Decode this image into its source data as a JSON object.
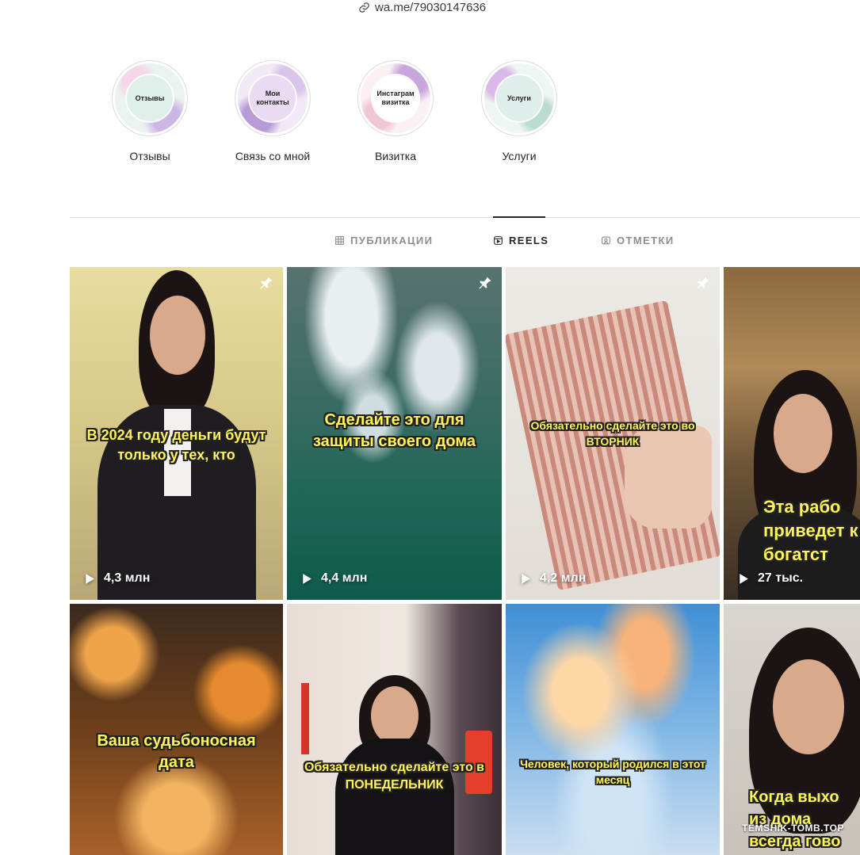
{
  "profile": {
    "link_text": "wa.me/79030147636"
  },
  "highlights": [
    {
      "cover_text": "Отзывы",
      "caption": "Отзывы",
      "tint": "#dff0ea"
    },
    {
      "cover_text": "Мои контакты",
      "caption": "Связь со мной",
      "tint": "#e9dcf2"
    },
    {
      "cover_text": "Инстаграм визитка",
      "caption": "Визитка",
      "tint": "#f7e4ec"
    },
    {
      "cover_text": "Услуги",
      "caption": "Услуги",
      "tint": "#dfeeea"
    }
  ],
  "tabs": [
    {
      "label": "ПУБЛИКАЦИИ",
      "active": false
    },
    {
      "label": "REELS",
      "active": true
    },
    {
      "label": "ОТМЕТКИ",
      "active": false
    }
  ],
  "reels": [
    {
      "caption": "В 2024 году деньги будут только у тех, кто",
      "views": "4,3 млн",
      "pinned": true
    },
    {
      "caption": "Сделайте это для защиты своего дома",
      "views": "4,4 млн",
      "pinned": true
    },
    {
      "caption": "Обязательно сделайте это во ВТОРНИК",
      "views": "4,2 млн",
      "pinned": true
    },
    {
      "caption": "Эта рабо приведет к богатст",
      "views": "27 тыс.",
      "pinned": false
    },
    {
      "caption": "Ваша судьбоносная дата",
      "views": "",
      "pinned": false
    },
    {
      "caption": "Обязательно сделайте это в ПОНЕДЕЛЬНИК",
      "views": "",
      "pinned": false
    },
    {
      "caption": "Человек, который родился в этот месяц",
      "views": "",
      "pinned": false
    },
    {
      "caption": "Когда выхо из дома всегда гово",
      "views": "",
      "pinned": false
    }
  ],
  "watermark": "TEMSHIK-TOMB.TOP",
  "colors": {
    "caption_text": "#fff35a",
    "tab_active": "#262626",
    "tab_inactive": "#8e8e8e",
    "divider": "#dbdbdb"
  }
}
